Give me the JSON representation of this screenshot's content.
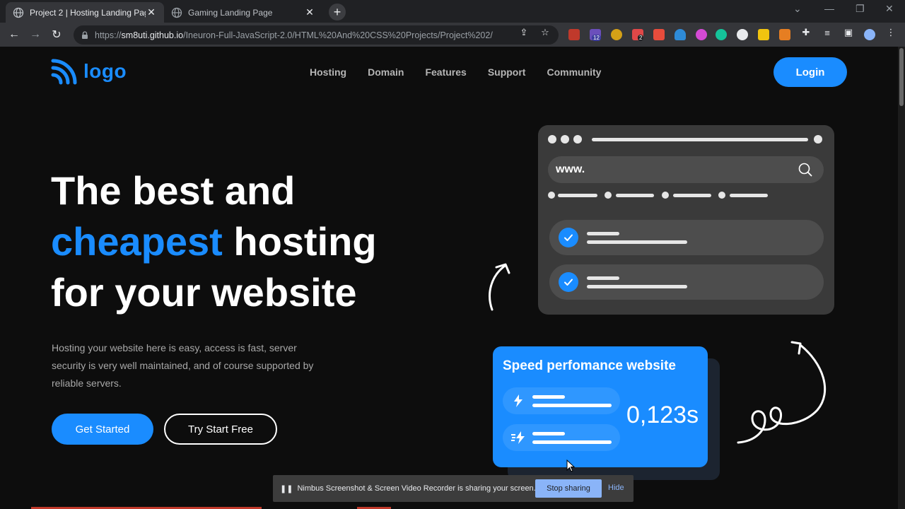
{
  "browser": {
    "tabs": [
      {
        "title": "Project 2 | Hosting Landing Page",
        "active": true
      },
      {
        "title": "Gaming Landing Page",
        "active": false
      }
    ],
    "url_prefix": "https://",
    "url_host": "sm8uti.github.io",
    "url_path": "/Ineuron-Full-JavaScript-2.0/HTML%20And%20CSS%20Projects/Project%202/",
    "extension_badges": [
      "12",
      "2"
    ]
  },
  "site": {
    "logo_text": "logo",
    "nav": [
      "Hosting",
      "Domain",
      "Features",
      "Support",
      "Community"
    ],
    "login_label": "Login",
    "hero": {
      "line1": "The best and",
      "highlight": "cheapest",
      "line2_rest": " hosting",
      "line3": "for your website",
      "description": "Hosting your website here is easy, access is fast, server security is very well maintained, and of course supported by reliable servers."
    },
    "buttons": {
      "primary": "Get Started",
      "secondary": "Try Start Free"
    },
    "illustration": {
      "search_text": "www.",
      "speed_title": "Speed perfomance website",
      "speed_value": "0,123s"
    }
  },
  "share_bar": {
    "message": "Nimbus Screenshot & Screen Video Recorder is sharing your screen.",
    "stop_label": "Stop sharing",
    "hide_label": "Hide"
  },
  "colors": {
    "accent": "#1a8cff",
    "background": "#0d0d0d",
    "card": "#3a3a3a"
  }
}
